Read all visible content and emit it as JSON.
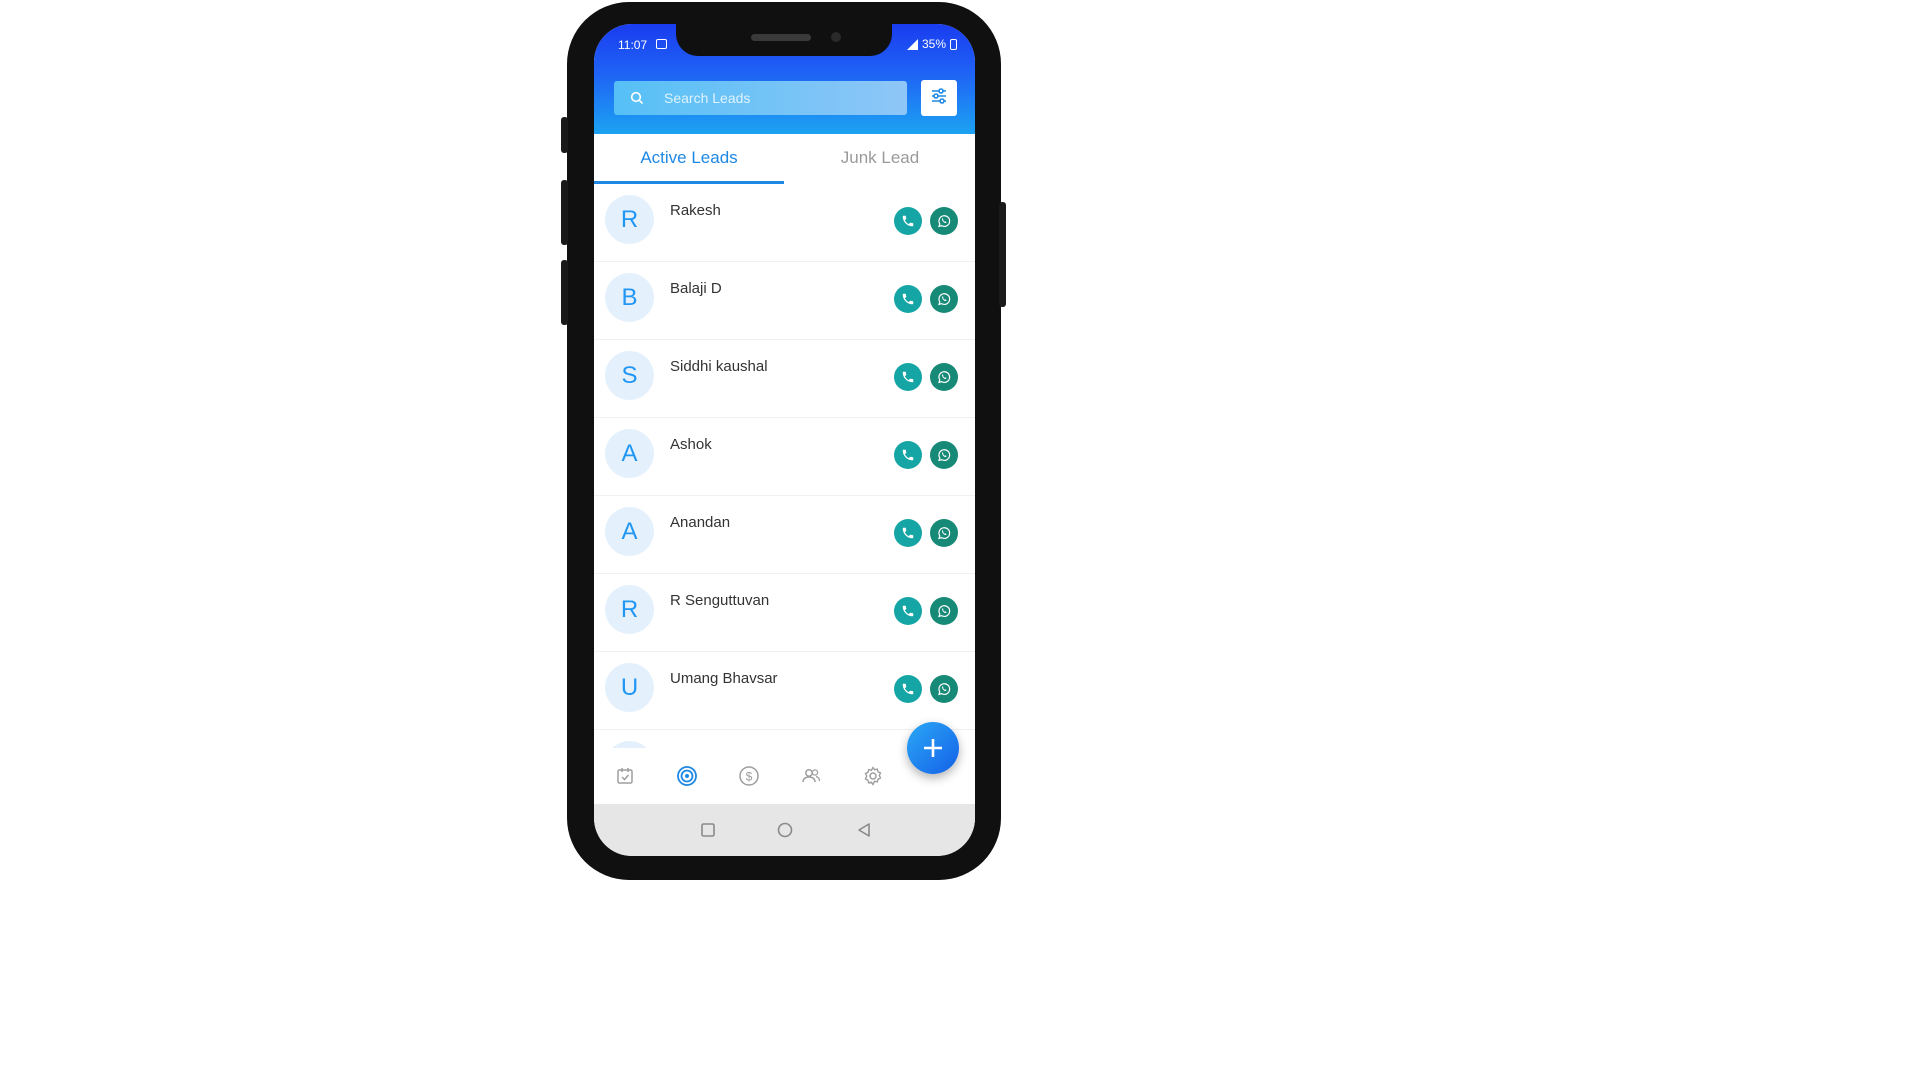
{
  "status_bar": {
    "time": "11:07",
    "battery": "35%"
  },
  "search": {
    "placeholder": "Search Leads"
  },
  "tabs": [
    {
      "label": "Active Leads"
    },
    {
      "label": "Junk Lead"
    }
  ],
  "leads": [
    {
      "initial": "R",
      "name": "Rakesh"
    },
    {
      "initial": "B",
      "name": "Balaji D"
    },
    {
      "initial": "S",
      "name": "Siddhi kaushal"
    },
    {
      "initial": "A",
      "name": "Ashok"
    },
    {
      "initial": "A",
      "name": "Anandan"
    },
    {
      "initial": "R",
      "name": "R Senguttuvan"
    },
    {
      "initial": "U",
      "name": "Umang Bhavsar"
    }
  ],
  "bottom_nav": [
    "calendar-icon",
    "target-icon",
    "dollar-icon",
    "users-icon",
    "settings-icon"
  ],
  "colors": {
    "header_top": "#1a3cf0",
    "header_bottom": "#1ca3f2",
    "accent": "#1e88e5",
    "call": "#16a5a5",
    "whatsapp": "#178a77"
  }
}
